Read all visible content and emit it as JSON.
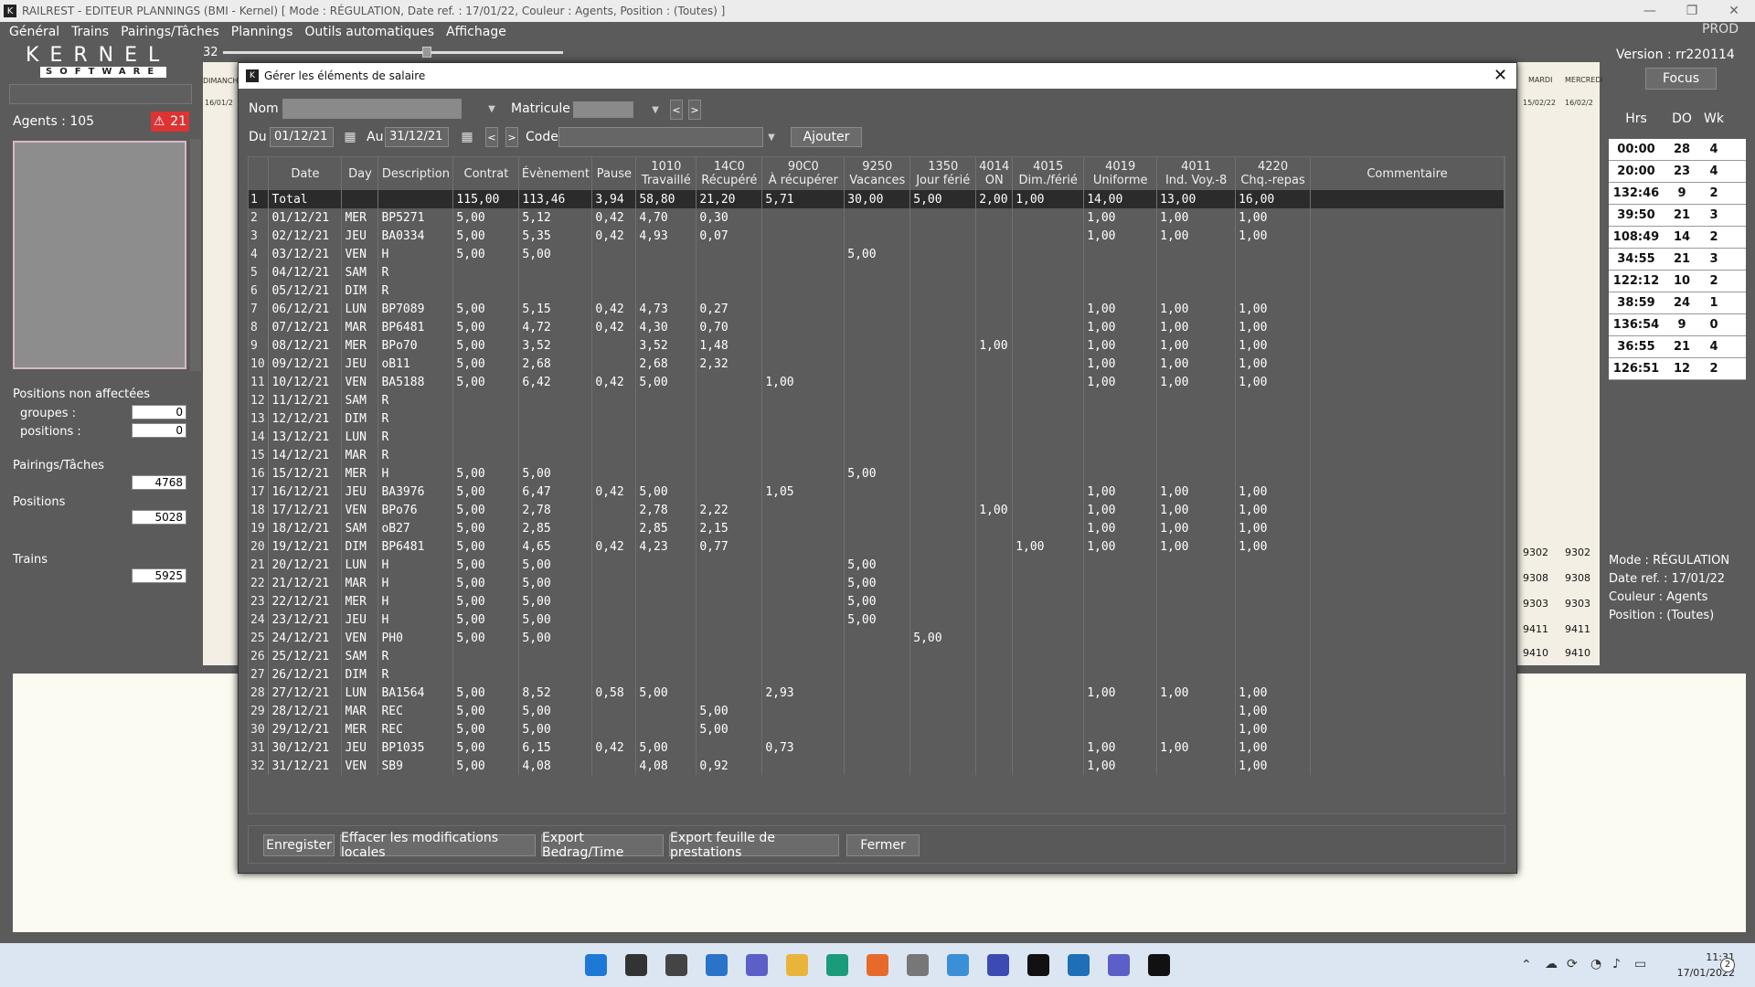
{
  "window": {
    "title": "RAILREST - EDITEUR PLANNINGS (BMI - Kernel)   [ Mode : RÉGULATION,  Date ref. : 17/01/22,  Couleur : Agents,  Position : (Toutes) ]",
    "prod_label": "PROD",
    "min_icon": "minimize-icon",
    "max_icon": "maximize-icon",
    "close_icon": "close-icon"
  },
  "menu": [
    "Général",
    "Trains",
    "Pairings/Tâches",
    "Plannings",
    "Outils automatiques",
    "Affichage"
  ],
  "left": {
    "logo_top": "KERNEL",
    "logo_bottom": "SOFTWARE",
    "agents_label": "Agents : 105",
    "alert_count": "21",
    "positions_title": "Positions non affectées",
    "groupes_label": "groupes :",
    "groupes_value": "0",
    "positions_label": "positions :",
    "positions_value": "0",
    "pairings_label": "Pairings/Tâches",
    "pairings_value": "4768",
    "positions2_label": "Positions",
    "positions2_value": "5028",
    "trains_label": "Trains",
    "trains_value": "5925"
  },
  "timeline": {
    "zoom_value": "32",
    "zoom_fraction": 0.6,
    "day_left": "DIMANCH",
    "date_left": "16/01/2",
    "day_mardi": "MARDI",
    "date_mardi": "15/02/22",
    "day_mercredi": "MERCREDI",
    "date_mercredi": "16/02/2"
  },
  "right": {
    "version": "Version : rr220114",
    "focus_label": "Focus",
    "col_hrs": "Hrs",
    "col_do": "DO",
    "col_wk": "Wk",
    "rows": [
      [
        "00:00",
        "28",
        "4"
      ],
      [
        "20:00",
        "23",
        "4"
      ],
      [
        "132:46",
        "9",
        "2"
      ],
      [
        "39:50",
        "21",
        "3"
      ],
      [
        "108:49",
        "14",
        "2"
      ],
      [
        "34:55",
        "21",
        "3"
      ],
      [
        "122:12",
        "10",
        "2"
      ],
      [
        "38:59",
        "24",
        "1"
      ],
      [
        "136:54",
        "9",
        "0"
      ],
      [
        "36:55",
        "21",
        "4"
      ],
      [
        "126:51",
        "12",
        "2"
      ]
    ],
    "info_mode": "Mode : RÉGULATION",
    "info_date": "Date ref. : 17/01/22",
    "info_couleur": "Couleur : Agents",
    "info_position": "Position : (Toutes)",
    "trains": [
      "9302",
      "9302",
      "9308",
      "9308",
      "9303",
      "9303",
      "9411",
      "9411",
      "9410",
      "9410"
    ]
  },
  "dialog": {
    "title": "Gérer les éléments de salaire",
    "nom_label": "Nom",
    "nom_value": "",
    "matricule_label": "Matricule",
    "matricule_value": "",
    "du_label": "Du",
    "du_value": "01/12/21",
    "au_label": "Au",
    "au_value": "31/12/21",
    "code_label": "Code",
    "code_value": "",
    "ajouter_label": "Ajouter",
    "columns": [
      {
        "l1": "",
        "l2": "Date"
      },
      {
        "l1": "",
        "l2": "Day"
      },
      {
        "l1": "",
        "l2": "Description"
      },
      {
        "l1": "",
        "l2": "Contrat"
      },
      {
        "l1": "",
        "l2": "Évènement"
      },
      {
        "l1": "",
        "l2": "Pause"
      },
      {
        "l1": "1010",
        "l2": "Travaillé"
      },
      {
        "l1": "14C0",
        "l2": "Récupéré"
      },
      {
        "l1": "90C0",
        "l2": "À récupérer"
      },
      {
        "l1": "9250",
        "l2": "Vacances"
      },
      {
        "l1": "1350",
        "l2": "Jour férié"
      },
      {
        "l1": "4014",
        "l2": "ON"
      },
      {
        "l1": "4015",
        "l2": "Dim./férié"
      },
      {
        "l1": "4019",
        "l2": "Uniforme"
      },
      {
        "l1": "4011",
        "l2": "Ind. Voy.-8"
      },
      {
        "l1": "4220",
        "l2": "Chq.-repas"
      },
      {
        "l1": "",
        "l2": "Commentaire"
      }
    ],
    "rows": [
      [
        "Total",
        "",
        "",
        "115,00",
        "113,46",
        "3,94",
        "58,80",
        "21,20",
        "5,71",
        "30,00",
        "5,00",
        "2,00",
        "1,00",
        "14,00",
        "13,00",
        "16,00",
        ""
      ],
      [
        "01/12/21",
        "MER",
        "BP5271",
        "5,00",
        "5,12",
        "0,42",
        "4,70",
        "0,30",
        "",
        "",
        "",
        "",
        "",
        "1,00",
        "1,00",
        "1,00",
        ""
      ],
      [
        "02/12/21",
        "JEU",
        "BA0334",
        "5,00",
        "5,35",
        "0,42",
        "4,93",
        "0,07",
        "",
        "",
        "",
        "",
        "",
        "1,00",
        "1,00",
        "1,00",
        ""
      ],
      [
        "03/12/21",
        "VEN",
        "H",
        "5,00",
        "5,00",
        "",
        "",
        "",
        "",
        "5,00",
        "",
        "",
        "",
        "",
        "",
        "",
        ""
      ],
      [
        "04/12/21",
        "SAM",
        "R",
        "",
        "",
        "",
        "",
        "",
        "",
        "",
        "",
        "",
        "",
        "",
        "",
        "",
        ""
      ],
      [
        "05/12/21",
        "DIM",
        "R",
        "",
        "",
        "",
        "",
        "",
        "",
        "",
        "",
        "",
        "",
        "",
        "",
        "",
        ""
      ],
      [
        "06/12/21",
        "LUN",
        "BP7089",
        "5,00",
        "5,15",
        "0,42",
        "4,73",
        "0,27",
        "",
        "",
        "",
        "",
        "",
        "1,00",
        "1,00",
        "1,00",
        ""
      ],
      [
        "07/12/21",
        "MAR",
        "BP6481",
        "5,00",
        "4,72",
        "0,42",
        "4,30",
        "0,70",
        "",
        "",
        "",
        "",
        "",
        "1,00",
        "1,00",
        "1,00",
        ""
      ],
      [
        "08/12/21",
        "MER",
        "BPo70",
        "5,00",
        "3,52",
        "",
        "3,52",
        "1,48",
        "",
        "",
        "",
        "1,00",
        "",
        "1,00",
        "1,00",
        "1,00",
        ""
      ],
      [
        "09/12/21",
        "JEU",
        "oB11",
        "5,00",
        "2,68",
        "",
        "2,68",
        "2,32",
        "",
        "",
        "",
        "",
        "",
        "1,00",
        "1,00",
        "1,00",
        ""
      ],
      [
        "10/12/21",
        "VEN",
        "BA5188",
        "5,00",
        "6,42",
        "0,42",
        "5,00",
        "",
        "1,00",
        "",
        "",
        "",
        "",
        "1,00",
        "1,00",
        "1,00",
        ""
      ],
      [
        "11/12/21",
        "SAM",
        "R",
        "",
        "",
        "",
        "",
        "",
        "",
        "",
        "",
        "",
        "",
        "",
        "",
        "",
        ""
      ],
      [
        "12/12/21",
        "DIM",
        "R",
        "",
        "",
        "",
        "",
        "",
        "",
        "",
        "",
        "",
        "",
        "",
        "",
        "",
        ""
      ],
      [
        "13/12/21",
        "LUN",
        "R",
        "",
        "",
        "",
        "",
        "",
        "",
        "",
        "",
        "",
        "",
        "",
        "",
        "",
        ""
      ],
      [
        "14/12/21",
        "MAR",
        "R",
        "",
        "",
        "",
        "",
        "",
        "",
        "",
        "",
        "",
        "",
        "",
        "",
        "",
        ""
      ],
      [
        "15/12/21",
        "MER",
        "H",
        "5,00",
        "5,00",
        "",
        "",
        "",
        "",
        "5,00",
        "",
        "",
        "",
        "",
        "",
        "",
        ""
      ],
      [
        "16/12/21",
        "JEU",
        "BA3976",
        "5,00",
        "6,47",
        "0,42",
        "5,00",
        "",
        "1,05",
        "",
        "",
        "",
        "",
        "1,00",
        "1,00",
        "1,00",
        ""
      ],
      [
        "17/12/21",
        "VEN",
        "BPo76",
        "5,00",
        "2,78",
        "",
        "2,78",
        "2,22",
        "",
        "",
        "",
        "1,00",
        "",
        "1,00",
        "1,00",
        "1,00",
        ""
      ],
      [
        "18/12/21",
        "SAM",
        "oB27",
        "5,00",
        "2,85",
        "",
        "2,85",
        "2,15",
        "",
        "",
        "",
        "",
        "",
        "1,00",
        "1,00",
        "1,00",
        ""
      ],
      [
        "19/12/21",
        "DIM",
        "BP6481",
        "5,00",
        "4,65",
        "0,42",
        "4,23",
        "0,77",
        "",
        "",
        "",
        "",
        "1,00",
        "1,00",
        "1,00",
        "1,00",
        ""
      ],
      [
        "20/12/21",
        "LUN",
        "H",
        "5,00",
        "5,00",
        "",
        "",
        "",
        "",
        "5,00",
        "",
        "",
        "",
        "",
        "",
        "",
        ""
      ],
      [
        "21/12/21",
        "MAR",
        "H",
        "5,00",
        "5,00",
        "",
        "",
        "",
        "",
        "5,00",
        "",
        "",
        "",
        "",
        "",
        "",
        ""
      ],
      [
        "22/12/21",
        "MER",
        "H",
        "5,00",
        "5,00",
        "",
        "",
        "",
        "",
        "5,00",
        "",
        "",
        "",
        "",
        "",
        "",
        ""
      ],
      [
        "23/12/21",
        "JEU",
        "H",
        "5,00",
        "5,00",
        "",
        "",
        "",
        "",
        "5,00",
        "",
        "",
        "",
        "",
        "",
        "",
        ""
      ],
      [
        "24/12/21",
        "VEN",
        "PH0",
        "5,00",
        "5,00",
        "",
        "",
        "",
        "",
        "",
        "5,00",
        "",
        "",
        "",
        "",
        "",
        ""
      ],
      [
        "25/12/21",
        "SAM",
        "R",
        "",
        "",
        "",
        "",
        "",
        "",
        "",
        "",
        "",
        "",
        "",
        "",
        "",
        ""
      ],
      [
        "26/12/21",
        "DIM",
        "R",
        "",
        "",
        "",
        "",
        "",
        "",
        "",
        "",
        "",
        "",
        "",
        "",
        "",
        ""
      ],
      [
        "27/12/21",
        "LUN",
        "BA1564",
        "5,00",
        "8,52",
        "0,58",
        "5,00",
        "",
        "2,93",
        "",
        "",
        "",
        "",
        "1,00",
        "1,00",
        "1,00",
        ""
      ],
      [
        "28/12/21",
        "MAR",
        "REC",
        "5,00",
        "5,00",
        "",
        "",
        "5,00",
        "",
        "",
        "",
        "",
        "",
        "",
        "",
        "1,00",
        ""
      ],
      [
        "29/12/21",
        "MER",
        "REC",
        "5,00",
        "5,00",
        "",
        "",
        "5,00",
        "",
        "",
        "",
        "",
        "",
        "",
        "",
        "1,00",
        ""
      ],
      [
        "30/12/21",
        "JEU",
        "BP1035",
        "5,00",
        "6,15",
        "0,42",
        "5,00",
        "",
        "0,73",
        "",
        "",
        "",
        "",
        "1,00",
        "1,00",
        "1,00",
        ""
      ],
      [
        "31/12/21",
        "VEN",
        "SB9",
        "5,00",
        "4,08",
        "",
        "4,08",
        "0,92",
        "",
        "",
        "",
        "",
        "",
        "1,00",
        "",
        "1,00",
        ""
      ]
    ],
    "buttons": {
      "enregistrer": "Enregister",
      "effacer": "Effacer les modifications locales",
      "export_bedrag": "Export Bedrag/Time",
      "export_feuille": "Export feuille de prestations",
      "fermer": "Fermer"
    }
  },
  "taskbar": {
    "time": "11:31",
    "date": "17/01/2022",
    "notif_count": "2",
    "icons": [
      "windows-start-icon",
      "search-icon",
      "task-view-icon",
      "widgets-icon",
      "chat-icon",
      "file-explorer-icon",
      "edge-icon",
      "firefox-icon",
      "settings-icon",
      "globe-icon",
      "app-icon",
      "terminal-icon",
      "window-icon",
      "teams-icon",
      "kernel-app-icon"
    ]
  }
}
